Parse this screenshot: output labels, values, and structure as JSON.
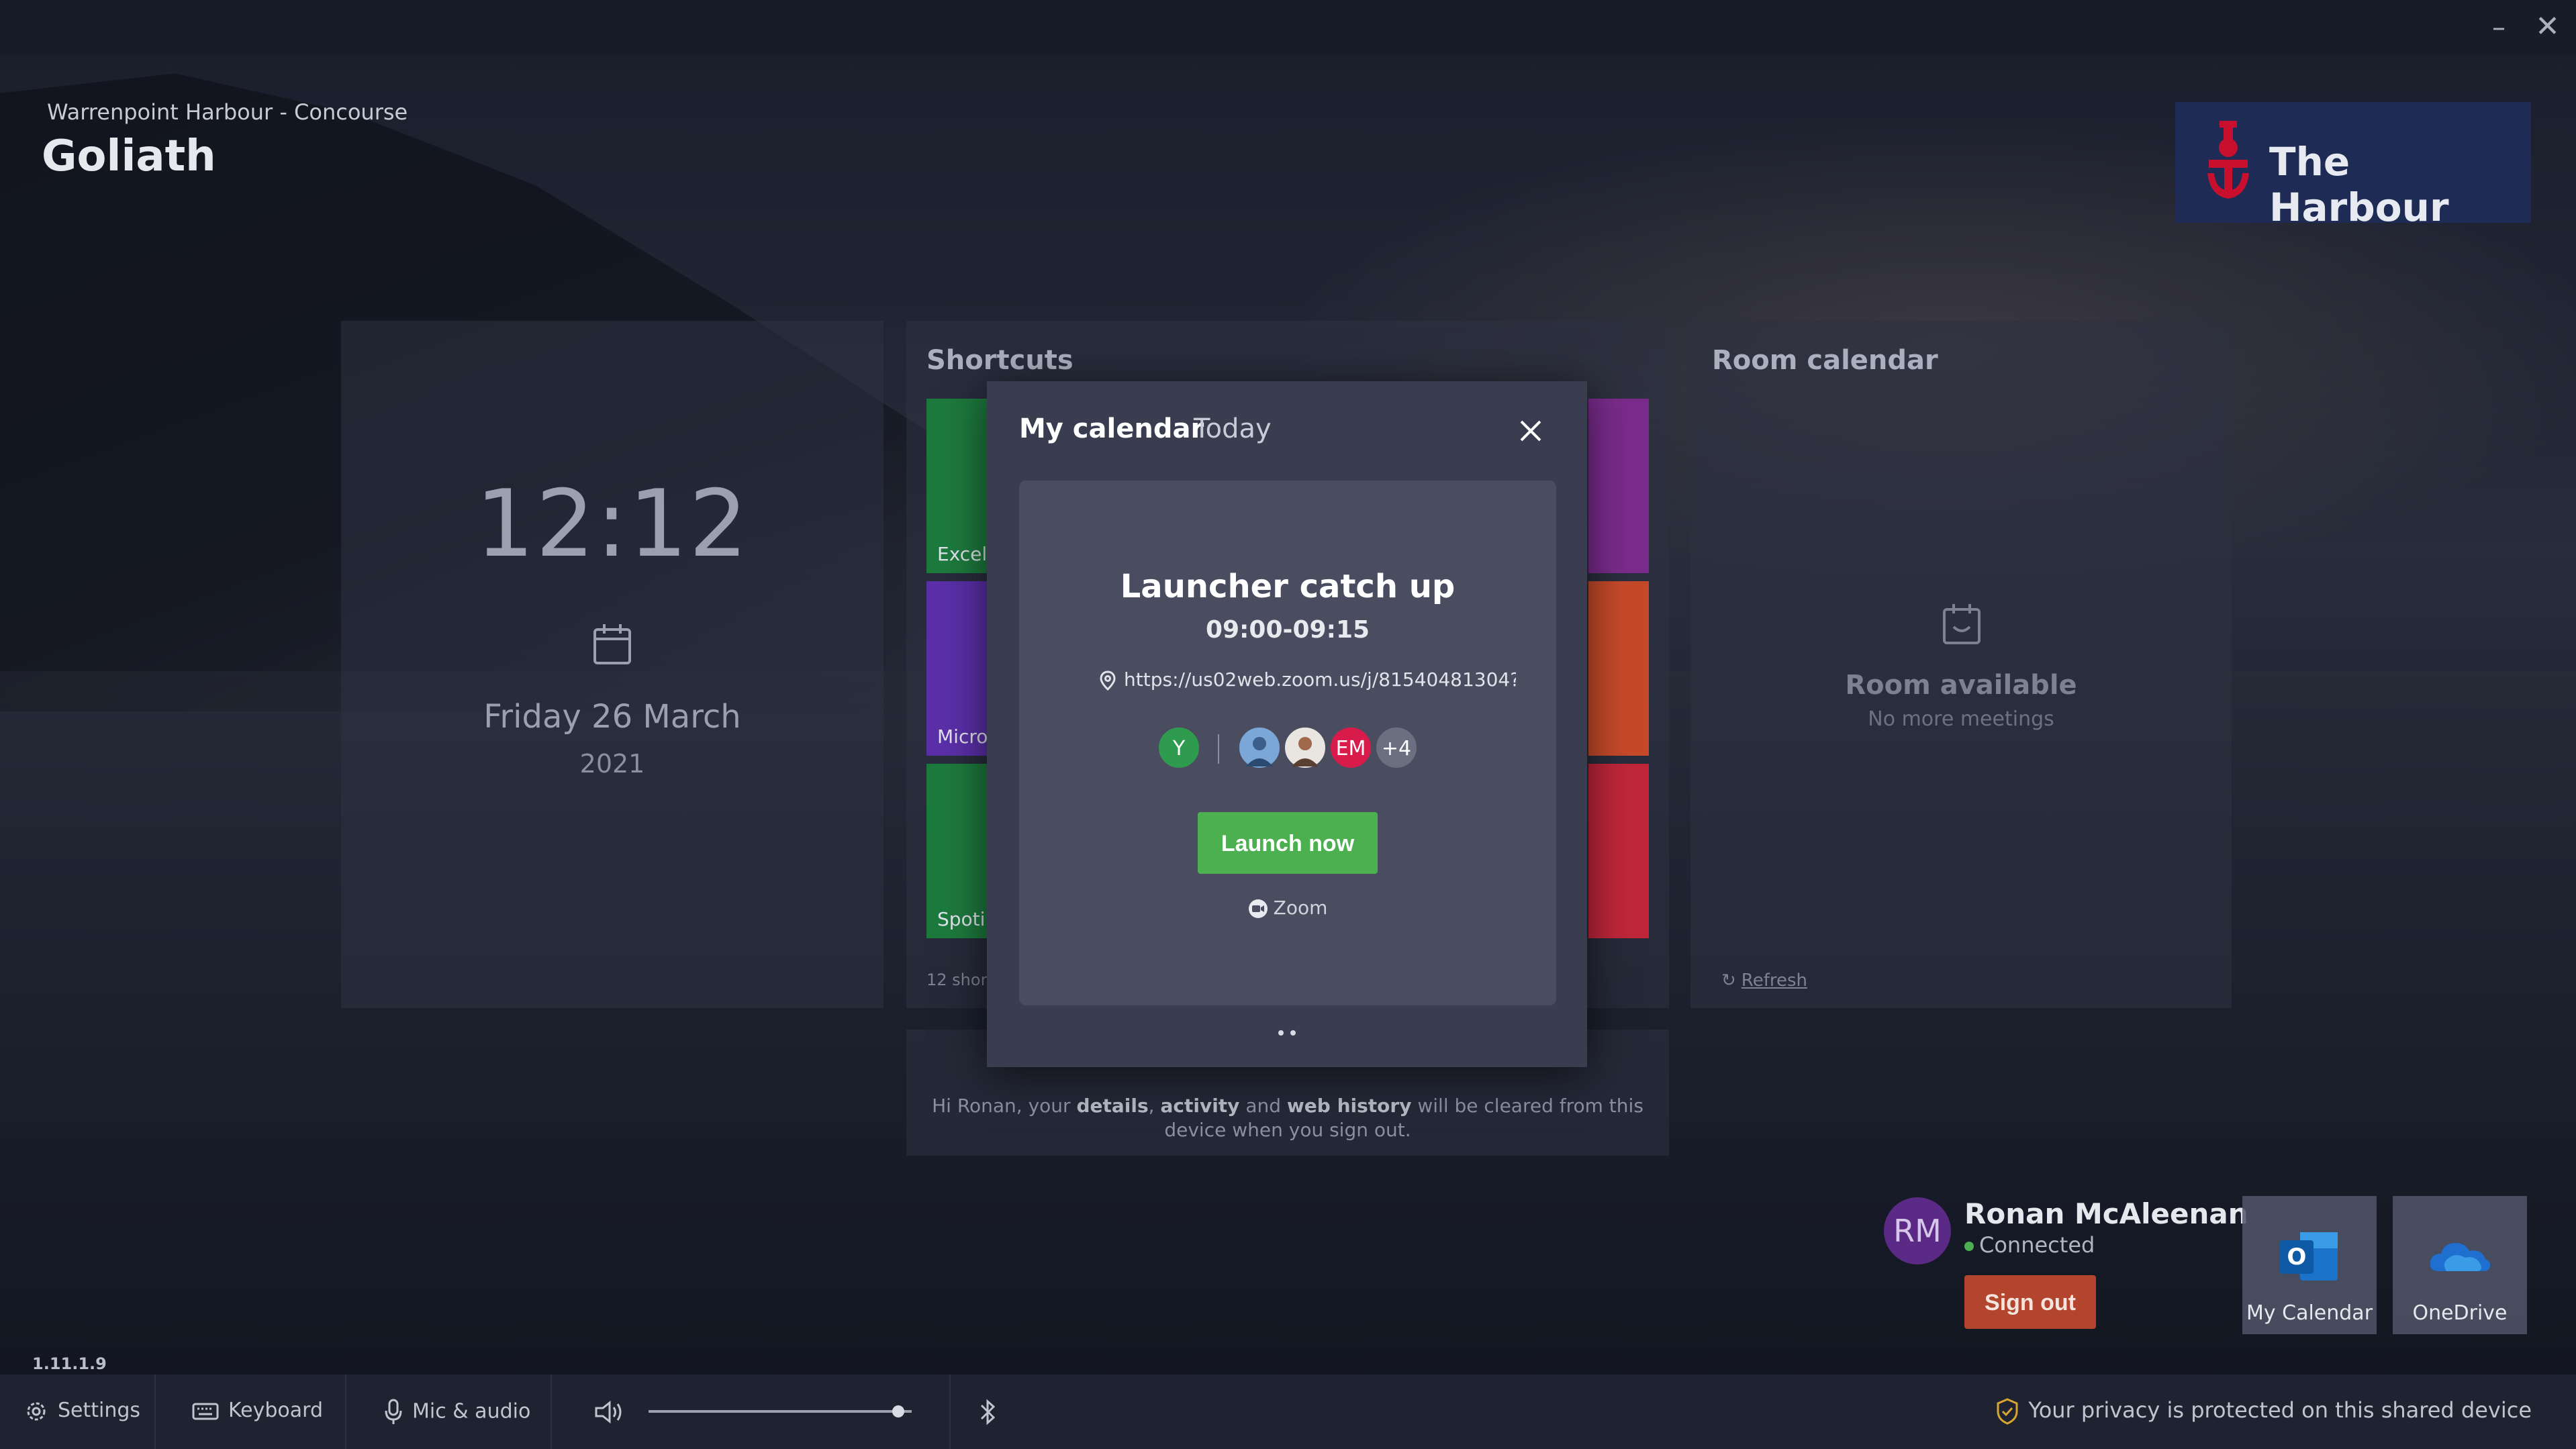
{
  "window": {
    "minimize_icon": "minimize-icon",
    "close_icon": "close-icon"
  },
  "header": {
    "location": "Warrenpoint Harbour - Concourse",
    "room_name": "Goliath"
  },
  "logo": {
    "text": "The Harbour",
    "brand_color": "#c8102e",
    "background": "#1e2b55"
  },
  "clock": {
    "time": "12:12",
    "date": "Friday 26 March",
    "year": "2021",
    "icon": "calendar-icon"
  },
  "shortcuts": {
    "title": "Shortcuts",
    "count_text": "12 short",
    "tiles": [
      {
        "label": "Excel",
        "color": "#1d7a3e"
      },
      {
        "label": "Micro",
        "color": "#5a2fa8"
      },
      {
        "label": "Spoti",
        "color": "#1d7a3e"
      },
      {
        "label": "",
        "color": "#7a2c8c"
      },
      {
        "label": "",
        "color": "#c64a2a"
      },
      {
        "label": "",
        "color": "#c0263a"
      }
    ]
  },
  "room_calendar": {
    "title": "Room calendar",
    "status": "Room available",
    "detail": "No more meetings",
    "refresh_label": "Refresh"
  },
  "privacy_panel": {
    "greeting": "Hi Ronan, your ",
    "details": "details",
    "sep1": ", ",
    "activity": "activity",
    "and": " and ",
    "web_history": "web history",
    "tail": " will be cleared from this device when you sign out."
  },
  "modal": {
    "title": "My calendar",
    "subtitle": "Today",
    "meeting": {
      "title": "Launcher catch up",
      "time": "09:00-09:15",
      "link": "https://us02web.zoom.us/j/81540481304?p...",
      "organizer": {
        "initials": "Y",
        "color": "#2e9b4e"
      },
      "attendees": [
        {
          "initials": "",
          "color": "#7aa6d8"
        },
        {
          "initials": "",
          "color": "#e9e5e0"
        },
        {
          "initials": "EM",
          "color": "#d81b4a"
        },
        {
          "initials": "+4",
          "color": "#6b6f80"
        }
      ],
      "launch_label": "Launch now",
      "provider": "Zoom"
    },
    "pages": 2
  },
  "user": {
    "initials": "RM",
    "name": "Ronan McAleenan",
    "status": "Connected",
    "signout_label": "Sign out"
  },
  "apps": [
    {
      "label": "My Calendar",
      "icon": "outlook-icon"
    },
    {
      "label": "OneDrive",
      "icon": "onedrive-icon"
    }
  ],
  "version": "1.11.1.9",
  "bottom_bar": {
    "settings": "Settings",
    "keyboard": "Keyboard",
    "mic": "Mic & audio",
    "volume_level": 0.95,
    "privacy": "Your privacy is protected on this shared device"
  }
}
